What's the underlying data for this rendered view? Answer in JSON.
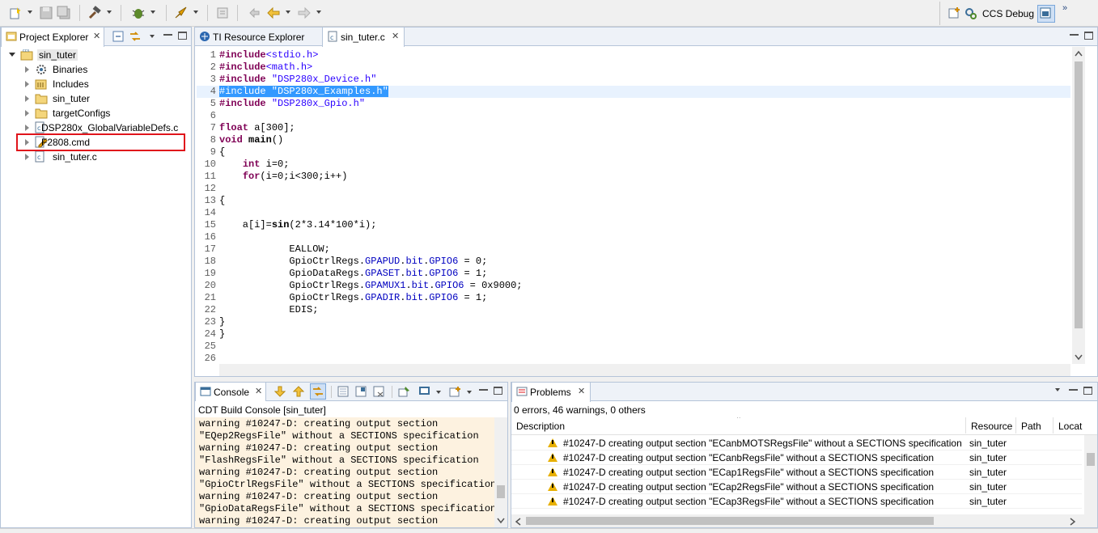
{
  "toolbar": {
    "perspective_label": "CCS Debug",
    "perspective_more": "»"
  },
  "project_explorer": {
    "tab_label": "Project Explorer",
    "project_root": "sin_tuter",
    "items": [
      {
        "label": "Binaries"
      },
      {
        "label": "Includes"
      },
      {
        "label": "sin_tuter"
      },
      {
        "label": "targetConfigs"
      },
      {
        "label": "DSP280x_GlobalVariableDefs.c"
      },
      {
        "label": "F2808.cmd"
      },
      {
        "label": "sin_tuter.c"
      }
    ]
  },
  "editor": {
    "tabs": [
      {
        "label": "TI Resource Explorer"
      },
      {
        "label": "sin_tuter.c"
      }
    ],
    "line_numbers": [
      "1",
      "2",
      "3",
      "4",
      "5",
      "6",
      "7",
      "8",
      "9",
      "10",
      "11",
      "12",
      "13",
      "14",
      "15",
      "16",
      "17",
      "18",
      "19",
      "20",
      "21",
      "22",
      "23",
      "24",
      "25",
      "26"
    ]
  },
  "console": {
    "tab_label": "Console",
    "title": "CDT Build Console [sin_tuter]",
    "lines": [
      "warning #10247-D: creating output section",
      "\"EQep2RegsFile\" without a SECTIONS specification",
      "warning #10247-D: creating output section",
      "\"FlashRegsFile\" without a SECTIONS specification",
      "warning #10247-D: creating output section",
      "\"GpioCtrlRegsFile\" without a SECTIONS specification",
      "warning #10247-D: creating output section",
      "\"GpioDataRegsFile\" without a SECTIONS specification",
      "warning #10247-D: creating output section"
    ]
  },
  "problems": {
    "tab_label": "Problems",
    "summary": "0 errors, 46 warnings, 0 others",
    "columns": {
      "description": "Description",
      "resource": "Resource",
      "path": "Path",
      "location": "Locat"
    },
    "rows": [
      {
        "description": "#10247-D creating output section \"ECanbMOTSRegsFile\" without a SECTIONS specification",
        "resource": "sin_tuter"
      },
      {
        "description": "#10247-D creating output section \"ECanbRegsFile\" without a SECTIONS specification",
        "resource": "sin_tuter"
      },
      {
        "description": "#10247-D creating output section \"ECap1RegsFile\" without a SECTIONS specification",
        "resource": "sin_tuter"
      },
      {
        "description": "#10247-D creating output section \"ECap2RegsFile\" without a SECTIONS specification",
        "resource": "sin_tuter"
      },
      {
        "description": "#10247-D creating output section \"ECap3RegsFile\" without a SECTIONS specification",
        "resource": "sin_tuter"
      }
    ]
  },
  "colors": {
    "highlight_box": "#e0141b",
    "keyword": "#7f0055",
    "string": "#2a00ff",
    "field": "#0000c0",
    "console_bg": "#fdf2e0"
  }
}
